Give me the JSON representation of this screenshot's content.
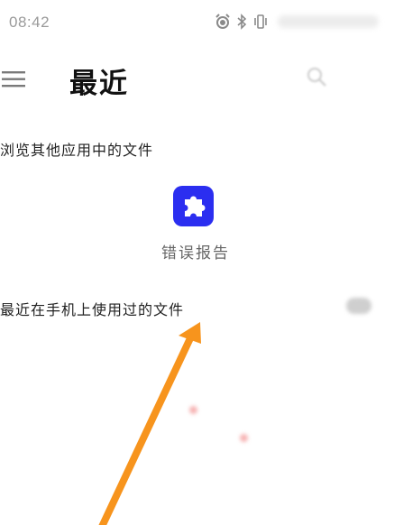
{
  "status_bar": {
    "time": "08:42"
  },
  "header": {
    "title": "最近",
    "menu_icon": "hamburger-menu-icon",
    "search_icon": "search-icon"
  },
  "browse_section": {
    "heading": "浏览其他应用中的文件",
    "apps": [
      {
        "label": "错误报告",
        "icon": "puzzle-icon",
        "icon_color": "#2b2ef0"
      }
    ]
  },
  "recent_section": {
    "heading": "最近在手机上使用过的文件"
  },
  "colors": {
    "app_icon_bg": "#2b2ef0",
    "annotation_arrow": "#f7941d"
  }
}
